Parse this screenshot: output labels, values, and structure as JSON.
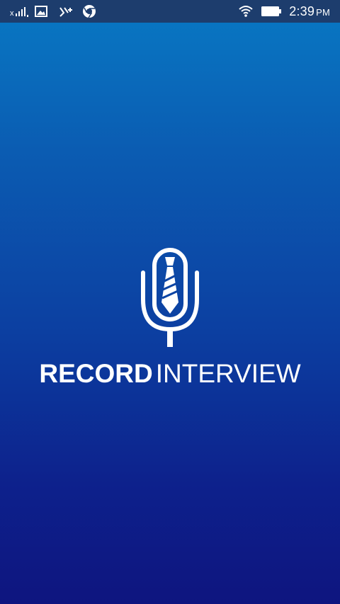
{
  "status_bar": {
    "time": "2:39",
    "ampm": "PM",
    "icons_left": [
      "signal-icon",
      "gallery-icon",
      "download-icon",
      "chrome-icon"
    ],
    "icons_right": [
      "wifi-icon",
      "battery-icon"
    ]
  },
  "splash": {
    "logo_icon": "microphone-tie-icon",
    "word_bold": "RECORD",
    "word_light": "INTERVIEW"
  },
  "colors": {
    "gradient_top": "#0879c4",
    "gradient_bottom": "#0e157f",
    "status_bar_bg": "#1d3d6d",
    "foreground": "#ffffff"
  }
}
